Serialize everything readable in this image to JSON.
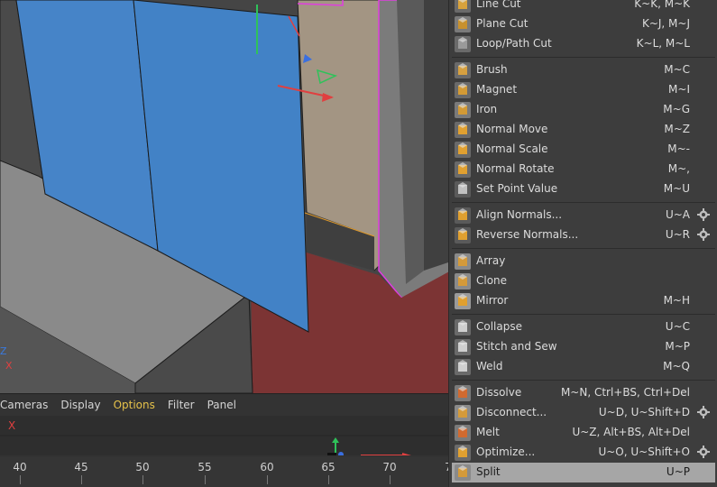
{
  "viewport": {
    "axis_z": "Z",
    "axis_x": "X"
  },
  "timeline": {
    "menu": [
      "Cameras",
      "Display",
      "Options",
      "Filter",
      "Panel"
    ],
    "active_menu": "Options",
    "ruler_ticks": [
      "40",
      "45",
      "50",
      "55",
      "60",
      "65",
      "70",
      "7"
    ],
    "x_marker": "X"
  },
  "menu": {
    "groups": [
      [
        {
          "label": "Line Cut",
          "shortcut": "K~K, M~K",
          "icon": "line-cut-icon",
          "gear": false
        },
        {
          "label": "Plane Cut",
          "shortcut": "K~J, M~J",
          "icon": "plane-cut-icon",
          "gear": false
        },
        {
          "label": "Loop/Path Cut",
          "shortcut": "K~L, M~L",
          "icon": "loop-cut-icon",
          "gear": false
        }
      ],
      [
        {
          "label": "Brush",
          "shortcut": "M~C",
          "icon": "brush-icon",
          "gear": false
        },
        {
          "label": "Magnet",
          "shortcut": "M~I",
          "icon": "magnet-icon",
          "gear": false
        },
        {
          "label": "Iron",
          "shortcut": "M~G",
          "icon": "iron-icon",
          "gear": false
        },
        {
          "label": "Normal Move",
          "shortcut": "M~Z",
          "icon": "normal-move-icon",
          "gear": false
        },
        {
          "label": "Normal Scale",
          "shortcut": "M~-",
          "icon": "normal-scale-icon",
          "gear": false
        },
        {
          "label": "Normal Rotate",
          "shortcut": "M~,",
          "icon": "normal-rotate-icon",
          "gear": false
        },
        {
          "label": "Set Point Value",
          "shortcut": "M~U",
          "icon": "xyz-icon",
          "gear": false
        }
      ],
      [
        {
          "label": "Align Normals...",
          "shortcut": "U~A",
          "icon": "align-normals-icon",
          "gear": true
        },
        {
          "label": "Reverse Normals...",
          "shortcut": "U~R",
          "icon": "reverse-normals-icon",
          "gear": true
        }
      ],
      [
        {
          "label": "Array",
          "shortcut": "",
          "icon": "array-icon",
          "gear": false
        },
        {
          "label": "Clone",
          "shortcut": "",
          "icon": "clone-icon",
          "gear": false
        },
        {
          "label": "Mirror",
          "shortcut": "M~H",
          "icon": "mirror-icon",
          "gear": false
        }
      ],
      [
        {
          "label": "Collapse",
          "shortcut": "U~C",
          "icon": "collapse-icon",
          "gear": false
        },
        {
          "label": "Stitch and Sew",
          "shortcut": "M~P",
          "icon": "stitch-icon",
          "gear": false
        },
        {
          "label": "Weld",
          "shortcut": "M~Q",
          "icon": "weld-icon",
          "gear": false
        }
      ],
      [
        {
          "label": "Dissolve",
          "shortcut": "M~N, Ctrl+BS, Ctrl+Del",
          "icon": "dissolve-icon",
          "gear": false
        },
        {
          "label": "Disconnect...",
          "shortcut": "U~D, U~Shift+D",
          "icon": "disconnect-icon",
          "gear": true
        },
        {
          "label": "Melt",
          "shortcut": "U~Z, Alt+BS, Alt+Del",
          "icon": "melt-icon",
          "gear": false
        },
        {
          "label": "Optimize...",
          "shortcut": "U~O, U~Shift+O",
          "icon": "optimize-icon",
          "gear": true
        },
        {
          "label": "Split",
          "shortcut": "U~P",
          "icon": "split-icon",
          "gear": false,
          "highlighted": true
        }
      ]
    ]
  }
}
